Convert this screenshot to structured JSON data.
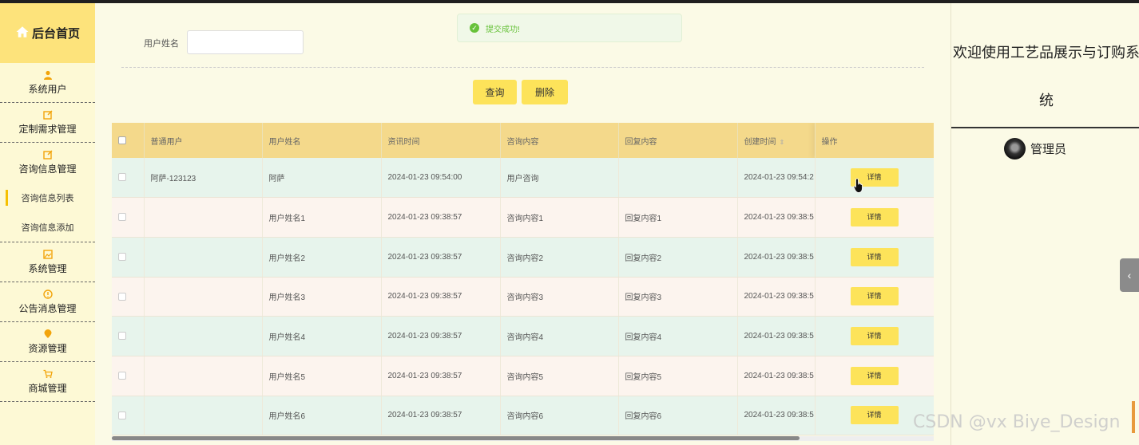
{
  "sidebar": {
    "home_label": "后台首页",
    "items": [
      {
        "label": "系统用户",
        "icon": "user-icon"
      },
      {
        "label": "定制需求管理",
        "icon": "edit-icon"
      },
      {
        "label": "咨询信息管理",
        "icon": "edit-icon"
      }
    ],
    "sub_items": [
      {
        "label": "咨询信息列表",
        "active": true
      },
      {
        "label": "咨询信息添加",
        "active": false
      }
    ],
    "items_after": [
      {
        "label": "系统管理",
        "icon": "image-icon"
      },
      {
        "label": "公告消息管理",
        "icon": "info-icon"
      },
      {
        "label": "资源管理",
        "icon": "location-icon"
      },
      {
        "label": "商城管理",
        "icon": "cart-icon"
      }
    ]
  },
  "search": {
    "label": "用户姓名",
    "value": "",
    "query_button": "查询",
    "delete_button": "删除"
  },
  "toast": {
    "message": "提交成功!"
  },
  "table": {
    "columns": [
      "普通用户",
      "用户姓名",
      "资讯时间",
      "咨询内容",
      "回复内容",
      "创建时间",
      "操作"
    ],
    "detail_label": "详情",
    "rows": [
      [
        "阿萨-123123",
        "阿萨",
        "2024-01-23 09:54:00",
        "用户咨询",
        "",
        "2024-01-23 09:54:2"
      ],
      [
        "",
        "用户姓名1",
        "2024-01-23 09:38:57",
        "咨询内容1",
        "回复内容1",
        "2024-01-23 09:38:5"
      ],
      [
        "",
        "用户姓名2",
        "2024-01-23 09:38:57",
        "咨询内容2",
        "回复内容2",
        "2024-01-23 09:38:5"
      ],
      [
        "",
        "用户姓名3",
        "2024-01-23 09:38:57",
        "咨询内容3",
        "回复内容3",
        "2024-01-23 09:38:5"
      ],
      [
        "",
        "用户姓名4",
        "2024-01-23 09:38:57",
        "咨询内容4",
        "回复内容4",
        "2024-01-23 09:38:5"
      ],
      [
        "",
        "用户姓名5",
        "2024-01-23 09:38:57",
        "咨询内容5",
        "回复内容5",
        "2024-01-23 09:38:5"
      ],
      [
        "",
        "用户姓名6",
        "2024-01-23 09:38:57",
        "咨询内容6",
        "回复内容6",
        "2024-01-23 09:38:5"
      ]
    ]
  },
  "right_panel": {
    "welcome_line1": "欢迎使用工艺品展示与订购系",
    "welcome_line2": "统",
    "user_name": "管理员"
  },
  "watermark": "CSDN @vx Biye_Design",
  "colors": {
    "accent": "#fde35a",
    "header": "#f4d98b",
    "sidebar_home": "#fde37b",
    "success": "#67c23a"
  }
}
